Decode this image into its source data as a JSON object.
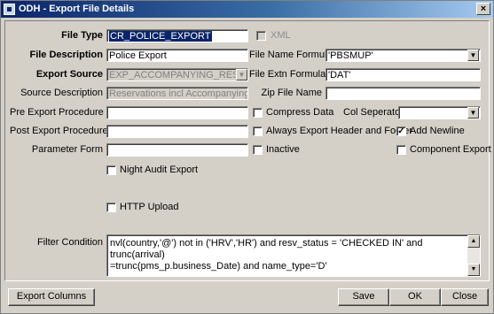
{
  "window": {
    "title": "ODH - Export File Details",
    "close_glyph": "×"
  },
  "fields": {
    "file_type": {
      "label": "File Type",
      "value": "CR_POLICE_EXPORT"
    },
    "xml": {
      "label": "XML"
    },
    "file_description": {
      "label": "File Description",
      "value": "Police Export"
    },
    "file_name_formula": {
      "label": "File Name Formula",
      "value": "'PBSMUP'"
    },
    "export_source": {
      "label": "Export Source",
      "value": "EXP_ACCOMPANYING_RESV_VIEW"
    },
    "file_extn_formula": {
      "label": "File Extn Formula",
      "value": "'DAT'"
    },
    "source_description": {
      "label": "Source Description",
      "value": "Reservations incl Accompanying Guests"
    },
    "zip_file_name": {
      "label": "Zip File Name",
      "value": ""
    },
    "pre_export_procedure": {
      "label": "Pre Export Procedure",
      "value": ""
    },
    "compress_data": {
      "label": "Compress Data",
      "checked": false
    },
    "col_separator": {
      "label": "Col Seperator",
      "value": ""
    },
    "post_export_procedure": {
      "label": "Post Export Procedure",
      "value": ""
    },
    "always_export_header": {
      "label": "Always Export Header and Footer",
      "checked": false
    },
    "add_newline": {
      "label": "Add Newline",
      "checked": true,
      "mark": "✓"
    },
    "parameter_form": {
      "label": "Parameter Form",
      "value": ""
    },
    "inactive": {
      "label": "Inactive",
      "checked": false
    },
    "component_export": {
      "label": "Component Export",
      "checked": false
    },
    "night_audit_export": {
      "label": "Night Audit Export",
      "checked": false
    },
    "http_upload": {
      "label": "HTTP Upload",
      "checked": false
    },
    "filter_condition": {
      "label": "Filter Condition",
      "line1": "nvl(country,'@') not in  ('HRV','HR') and resv_status = 'CHECKED IN' and trunc(arrival)",
      "line2": "=trunc(pms_p.business_Date) and name_type='D'"
    }
  },
  "glyphs": {
    "dropdown": "▼",
    "scroll_up": "▲",
    "scroll_down": "▼"
  },
  "buttons": {
    "export_columns": "Export Columns",
    "save": "Save",
    "ok": "OK",
    "close": "Close"
  }
}
